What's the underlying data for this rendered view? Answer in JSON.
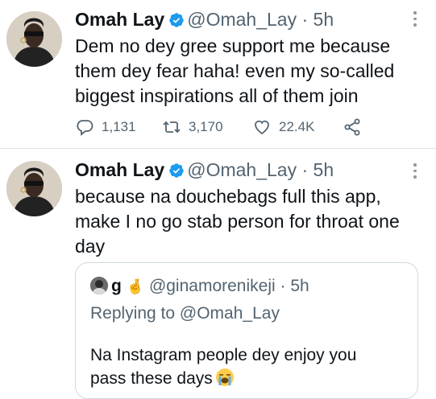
{
  "tweets": [
    {
      "name": "Omah Lay",
      "handle": "@Omah_Lay",
      "dot": "·",
      "time": "5h",
      "lines": [
        "Dem no dey gree support me because",
        "them dey fear haha! even my so-called",
        "biggest inspirations all of them join"
      ],
      "replies": "1,131",
      "retweets": "3,170",
      "likes": "22.4K"
    },
    {
      "name": "Omah Lay",
      "handle": "@Omah_Lay",
      "dot": "·",
      "time": "5h",
      "lines": [
        "because na douchebags full this app,",
        "make I no go stab person for throat one",
        "day"
      ]
    }
  ],
  "quote": {
    "name": "g",
    "name_emoji": "🤞",
    "handle": "@ginamorenikeji",
    "dot": "·",
    "time": "5h",
    "replying": "Replying to @Omah_Lay",
    "lines": [
      "Na Instagram people dey enjoy you",
      "pass these days"
    ],
    "end_emoji": "😭"
  },
  "icons": {
    "verified": "verified-badge-icon",
    "reply": "reply-icon",
    "retweet": "retweet-icon",
    "like": "heart-icon",
    "share": "share-icon",
    "more": "more-icon"
  },
  "colors": {
    "verified": "#1d9bf0",
    "secondary": "#536471",
    "border": "#cfd9de"
  }
}
